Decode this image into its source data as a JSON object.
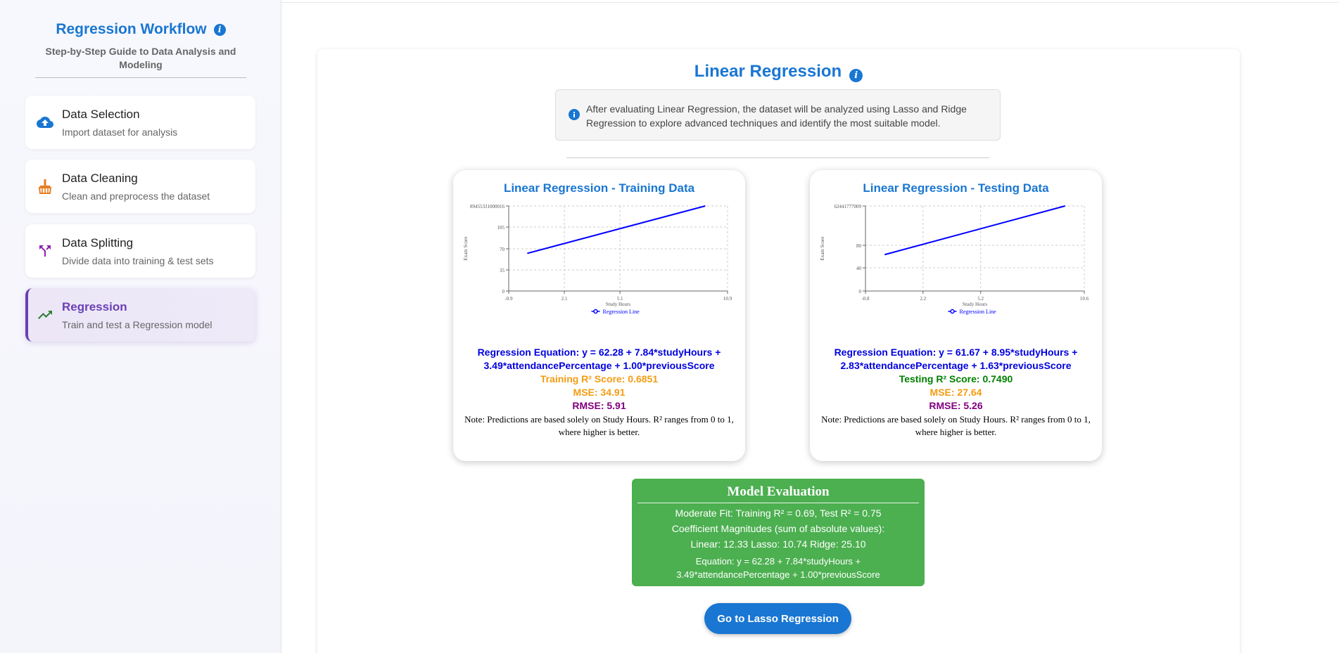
{
  "sidebar": {
    "title": "Regression Workflow",
    "subtitle": "Step-by-Step Guide to Data Analysis and Modeling",
    "steps": [
      {
        "title": "Data Selection",
        "desc": "Import dataset for analysis",
        "icon": "cloud-upload-icon"
      },
      {
        "title": "Data Cleaning",
        "desc": "Clean and preprocess the dataset",
        "icon": "broom-icon"
      },
      {
        "title": "Data Splitting",
        "desc": "Divide data into training & test sets",
        "icon": "split-icon"
      },
      {
        "title": "Regression",
        "desc": "Train and test a Regression model",
        "icon": "trending-up-icon"
      }
    ]
  },
  "main": {
    "title": "Linear Regression",
    "note": "After evaluating Linear Regression, the dataset will be analyzed using Lasso and Ridge Regression to explore advanced techniques and identify the most suitable model."
  },
  "training": {
    "title": "Linear Regression - Training Data",
    "equation": "Regression Equation: y = 62.28 + 7.84*studyHours + 3.49*attendancePercentage + 1.00*previousScore",
    "r2": "Training R² Score: 0.6851",
    "mse": "MSE: 34.91",
    "rmse": "RMSE: 5.91",
    "note": "Note: Predictions are based solely on Study Hours. R² ranges from 0 to 1, where higher is better."
  },
  "testing": {
    "title": "Linear Regression - Testing Data",
    "equation": "Regression Equation: y = 61.67 + 8.95*studyHours + 2.83*attendancePercentage + 1.63*previousScore",
    "r2": "Testing R² Score: 0.7490",
    "mse": "MSE: 27.64",
    "rmse": "RMSE: 5.26",
    "note": "Note: Predictions are based solely on Study Hours. R² ranges from 0 to 1, where higher is better."
  },
  "evaluation": {
    "title": "Model Evaluation",
    "fit": "Moderate Fit: Training R² = 0.69, Test R² = 0.75",
    "coef_label": "Coefficient Magnitudes (sum of absolute values):",
    "coef_values": "Linear: 12.33 Lasso: 10.74 Ridge: 25.10",
    "equation": "Equation: y = 62.28 + 7.84*studyHours + 3.49*attendancePercentage + 1.00*previousScore"
  },
  "button": {
    "label": "Go to Lasso Regression"
  },
  "colors": {
    "accent": "#1976d2",
    "eval_bg": "#4caf50",
    "active": "#6a3fb4",
    "r2_train": "#f39c12",
    "r2_test": "#008000",
    "rmse": "#800080",
    "line": "#0000ff"
  },
  "chart_data": [
    {
      "type": "line",
      "xlabel": "Study Hours",
      "ylabel": "Exam Score",
      "xticks": [
        "-0.9",
        "2.1",
        "5.1",
        "10.9"
      ],
      "yticks": [
        "0",
        "35",
        "70",
        "105",
        "89455331000016"
      ],
      "xlim": [
        -0.9,
        10.9
      ],
      "ylim": [
        0,
        140
      ],
      "legend": "top-bottom",
      "series": [
        {
          "name": "Regression Line",
          "x": [
            0.1,
            9.7
          ],
          "y": [
            62,
            140
          ]
        }
      ]
    },
    {
      "type": "line",
      "xlabel": "Study Hours",
      "ylabel": "Exam Score",
      "xticks": [
        "-0.8",
        "2.2",
        "5.2",
        "10.6"
      ],
      "yticks": [
        "0",
        "40",
        "80",
        "62441777009"
      ],
      "xlim": [
        -0.8,
        10.6
      ],
      "ylim": [
        0,
        145
      ],
      "legend": "bottom",
      "series": [
        {
          "name": "Regression Line",
          "x": [
            0.2,
            9.6
          ],
          "y": [
            62,
            145
          ]
        }
      ]
    }
  ]
}
